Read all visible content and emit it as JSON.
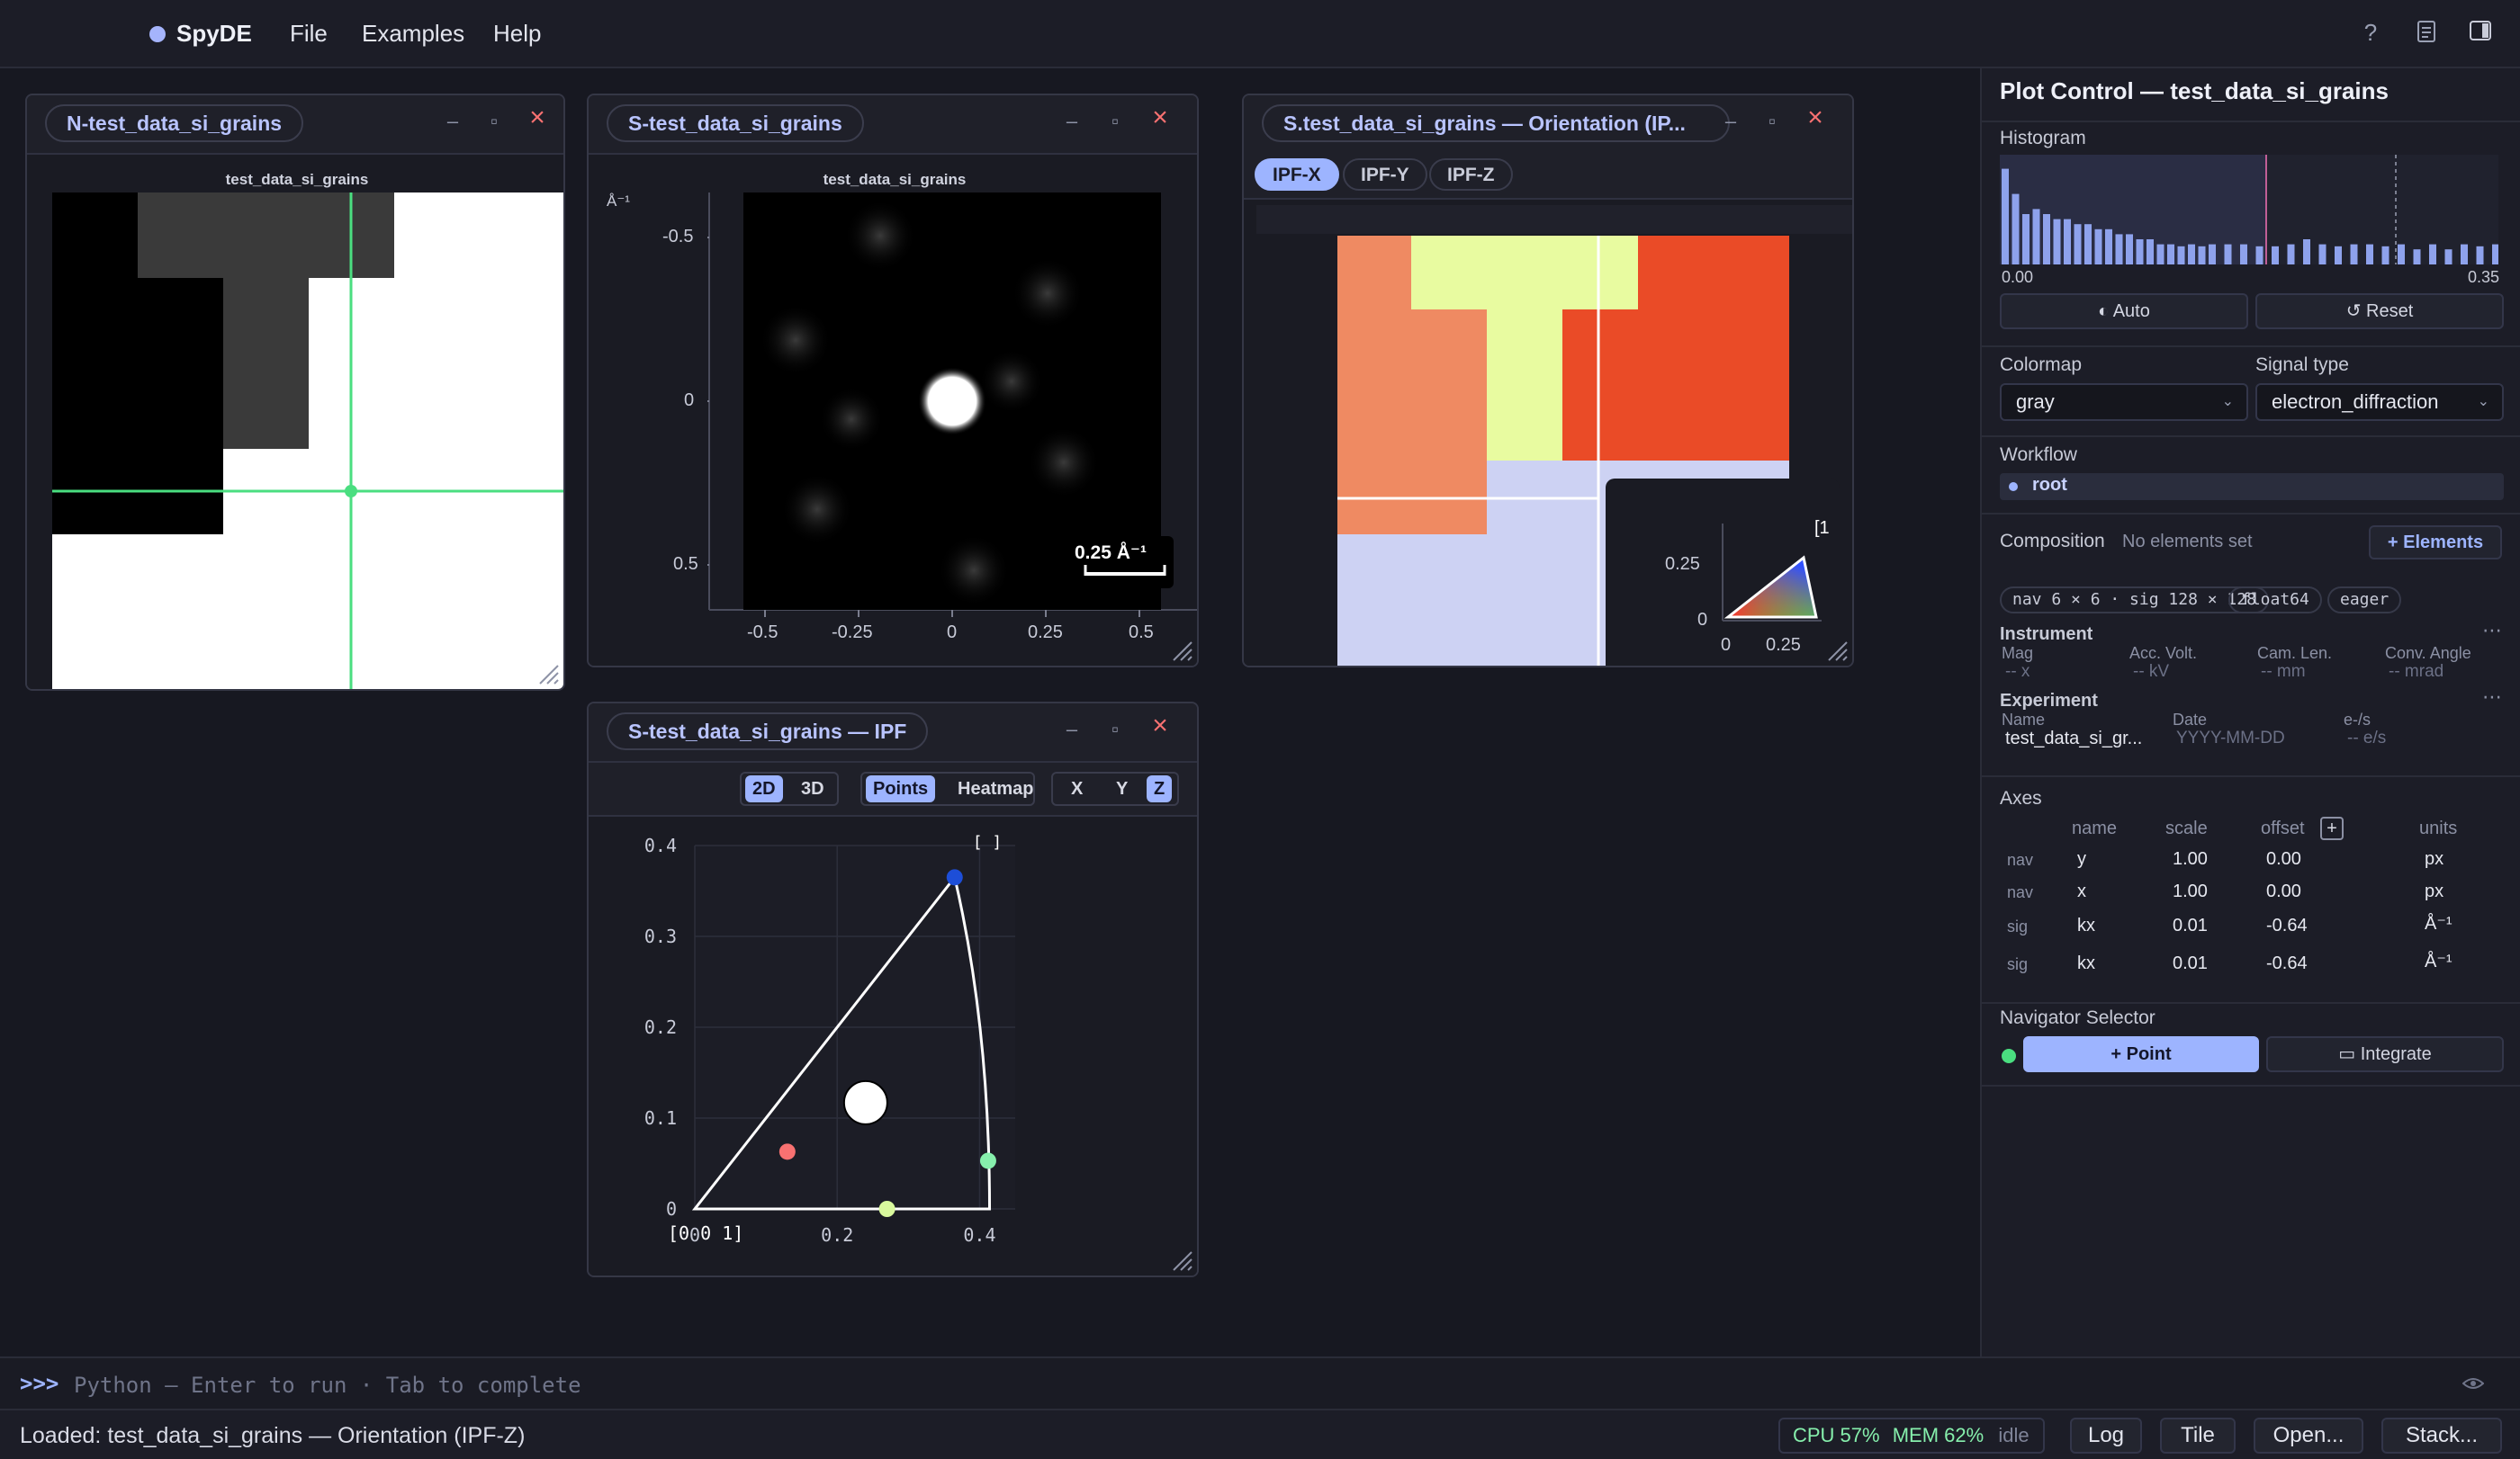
{
  "app": {
    "name": "SpyDE"
  },
  "menu": [
    "File",
    "Examples",
    "Help"
  ],
  "topbar_icons": [
    "help-icon",
    "document-icon",
    "panel-toggle-icon"
  ],
  "windows": {
    "nav": {
      "title": "N-test_data_si_grains",
      "caption": "test_data_si_grains"
    },
    "signal": {
      "title": "S-test_data_si_grains",
      "caption": "test_data_si_grains",
      "unit_label": "Å⁻¹",
      "yticks": [
        "-0.5",
        "0",
        "0.5"
      ],
      "xticks": [
        "-0.5",
        "-0.25",
        "0",
        "0.25",
        "0.5"
      ],
      "scalebar": "0.25 Å⁻¹"
    },
    "orientation": {
      "title": "S.test_data_si_grains — Orientation (IP...",
      "tabs": [
        "IPF-X",
        "IPF-Y",
        "IPF-Z"
      ],
      "active_tab": "IPF-X",
      "inset_yticks": [
        "0.25",
        "0"
      ],
      "inset_xticks": [
        "0",
        "0.25"
      ],
      "inset_corner": "[1"
    },
    "ipf": {
      "title": "S-test_data_si_grains — IPF",
      "toolbar": [
        "2D",
        "3D",
        "Points",
        "Heatmap",
        "X",
        "Y",
        "Z"
      ],
      "active": [
        "2D",
        "Points",
        "Z"
      ],
      "corner_label": "[0 0 1]",
      "top_label": "[  ]"
    }
  },
  "chart_data": {
    "type": "scatter",
    "title": "",
    "xlabel": "",
    "ylabel": "",
    "xlim": [
      0,
      0.45
    ],
    "ylim": [
      0,
      0.4
    ],
    "xticks": [
      "0",
      "0.2",
      "0.4"
    ],
    "yticks": [
      "0",
      "0.1",
      "0.2",
      "0.3",
      "0.4"
    ],
    "points": [
      {
        "x": 0.365,
        "y": 0.365,
        "color": "#1d4ed8"
      },
      {
        "x": 0.13,
        "y": 0.063,
        "color": "#f87171"
      },
      {
        "x": 0.24,
        "y": 0.117,
        "color": "#ffffff"
      },
      {
        "x": 0.27,
        "y": 0.0,
        "color": "#d9f99d"
      },
      {
        "x": 0.412,
        "y": 0.053,
        "color": "#86efac"
      }
    ],
    "grid": true,
    "legend": "none"
  },
  "panel": {
    "title": "Plot Control — test_data_si_grains",
    "histogram": {
      "label": "Histogram",
      "min": "0.00",
      "max": "0.35",
      "bars": [
        0.95,
        0.7,
        0.5,
        0.55,
        0.5,
        0.45,
        0.45,
        0.4,
        0.4,
        0.35,
        0.35,
        0.3,
        0.3,
        0.25,
        0.25,
        0.2,
        0.2,
        0.18,
        0.2,
        0.18,
        0.2,
        0.2,
        0.2,
        0.18,
        0.18,
        0.2,
        0.25,
        0.2,
        0.18,
        0.2,
        0.2,
        0.18,
        0.2,
        0.15,
        0.2,
        0.15,
        0.2,
        0.18,
        0.2,
        0.15
      ]
    },
    "auto_label": "◐ Auto",
    "reset_label": "↺ Reset",
    "colormap": {
      "label": "Colormap",
      "value": "gray"
    },
    "signal_type": {
      "label": "Signal type",
      "value": "electron_diffraction"
    },
    "workflow": {
      "label": "Workflow",
      "root": "root"
    },
    "composition": {
      "label": "Composition",
      "note": "No elements set",
      "button": "+ Elements"
    },
    "chips": [
      "nav 6 × 6 · sig 128 × 128",
      "float64",
      "eager"
    ],
    "instrument": {
      "label": "Instrument",
      "fields": [
        {
          "name": "Mag",
          "value": "-- x"
        },
        {
          "name": "Acc. Volt.",
          "value": "-- kV"
        },
        {
          "name": "Cam. Len.",
          "value": "-- mm"
        },
        {
          "name": "Conv. Angle",
          "value": "-- mrad"
        }
      ]
    },
    "experiment": {
      "label": "Experiment",
      "fields": [
        {
          "name": "Name",
          "value": "test_data_si_gr..."
        },
        {
          "name": "Date",
          "value": "YYYY-MM-DD"
        },
        {
          "name": "e-/s",
          "value": "-- e/s"
        }
      ]
    },
    "axes": {
      "label": "Axes",
      "headers": [
        "name",
        "scale",
        "offset",
        "units"
      ],
      "add": "+",
      "rows": [
        {
          "kind": "nav",
          "name": "y",
          "scale": "1.00",
          "offset": "0.00",
          "units": "px"
        },
        {
          "kind": "nav",
          "name": "x",
          "scale": "1.00",
          "offset": "0.00",
          "units": "px"
        },
        {
          "kind": "sig",
          "name": "kx",
          "scale": "0.01",
          "offset": "-0.64",
          "units": "Å⁻¹"
        },
        {
          "kind": "sig",
          "name": "kx",
          "scale": "0.01",
          "offset": "-0.64",
          "units": "Å⁻¹"
        }
      ]
    },
    "navigator": {
      "label": "Navigator Selector",
      "point": "+ Point",
      "integrate": "▭ Integrate"
    }
  },
  "console": {
    "prompt": ">>>",
    "placeholder": "Python — Enter to run · Tab to complete"
  },
  "status": {
    "message": "Loaded: test_data_si_grains — Orientation (IPF-Z)",
    "cpu": "CPU 57%",
    "mem": "MEM 62%",
    "state": "idle",
    "buttons": [
      "Log",
      "Tile",
      "Open...",
      "Stack..."
    ]
  },
  "colors": {
    "accent": "#9db4ff",
    "crosshair": "#4ade80",
    "close": "#f87171"
  }
}
